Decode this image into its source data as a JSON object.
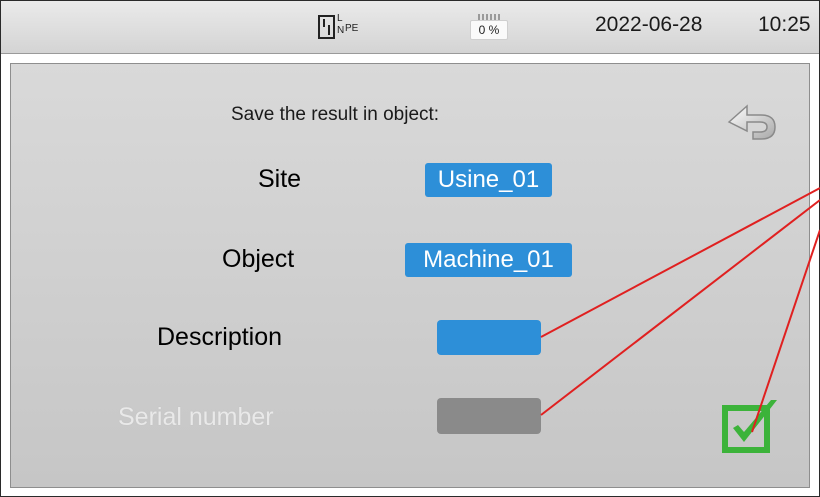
{
  "status_bar": {
    "wiring_labels": {
      "l": "L",
      "n": "N",
      "pe": "PE"
    },
    "battery_percent": "0 %",
    "date": "2022-06-28",
    "time": "10:25"
  },
  "dialog": {
    "heading": "Save the result in object:",
    "fields": [
      {
        "label": "Site",
        "value": "Usine_01",
        "enabled": true
      },
      {
        "label": "Object",
        "value": "Machine_01",
        "enabled": true
      },
      {
        "label": "Description",
        "value": "",
        "enabled": true
      },
      {
        "label": "Serial number",
        "value": "",
        "enabled": false
      }
    ]
  },
  "icons": {
    "back": "return-arrow-icon",
    "confirm": "green-checkmark-icon"
  },
  "colors": {
    "field_selected": "#2d8fd8",
    "field_disabled": "#8a8a8a",
    "confirm_green": "#3cb33a",
    "annotation_line": "#e02020"
  }
}
